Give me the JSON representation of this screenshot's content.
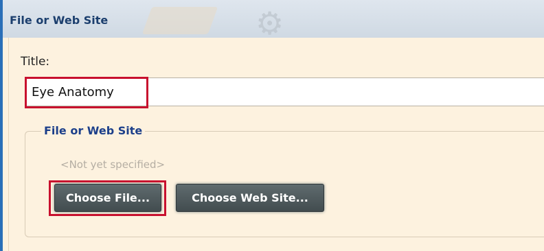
{
  "header": {
    "title": "File or Web Site"
  },
  "form": {
    "title_label": "Title:",
    "title_value": "Eye Anatomy"
  },
  "source_group": {
    "legend": "File or Web Site",
    "status": "<Not yet specified>",
    "choose_file_label": "Choose File...",
    "choose_web_site_label": "Choose Web Site..."
  },
  "colors": {
    "window_border": "#2a6fb8",
    "panel_background": "#fdf2df",
    "highlight": "#c8102e",
    "button": "#4f5a5d"
  },
  "icons": {
    "header_decoration": "gear-icon"
  }
}
